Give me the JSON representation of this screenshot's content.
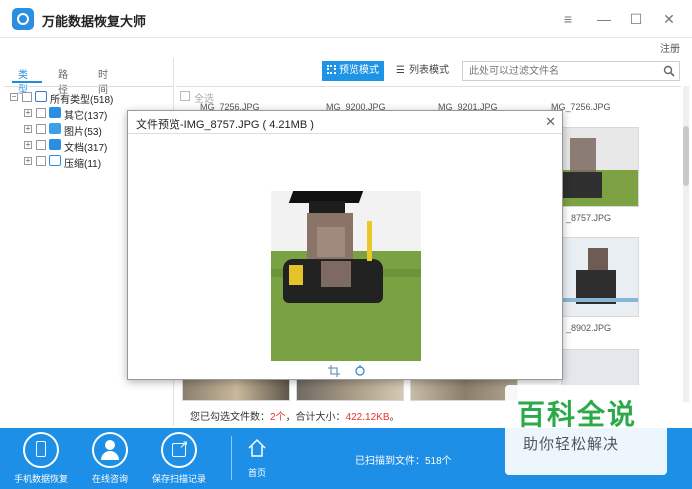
{
  "app": {
    "title": "万能数据恢复大师",
    "register": "注册"
  },
  "tabs": [
    "类型",
    "路径",
    "时间"
  ],
  "tree": [
    {
      "label": "所有类型(518)",
      "icon": "monitor-icon",
      "color": "#3a78c8"
    },
    {
      "label": "其它(137)",
      "icon": "grid-icon",
      "color": "#2a8fe0"
    },
    {
      "label": "图片(53)",
      "icon": "image-icon",
      "color": "#3aa0e8"
    },
    {
      "label": "文档(317)",
      "icon": "folder-icon",
      "color": "#2a8fe0"
    },
    {
      "label": "压缩(11)",
      "icon": "archive-icon",
      "color": "#2a8fe0"
    }
  ],
  "toolbar": {
    "preview_label": "预览模式",
    "list_label": "列表模式",
    "filter_placeholder": "此处可以过滤文件名"
  },
  "grid": {
    "select_all": "全选",
    "names": [
      "MG_7256.JPG",
      "MG_9200.JPG",
      "MG_9201.JPG",
      "MG_7256.JPG",
      "_8757.JPG",
      "_8902.JPG"
    ]
  },
  "status": {
    "prefix": "您已勾选文件数：",
    "count": "2个",
    "middle": "，合计大小：",
    "size": "422.12KB",
    "suffix": "。"
  },
  "bottom": {
    "phone_recover": "手机数据恢复",
    "online_consult": "在线咨询",
    "save_scan": "保存扫描记录",
    "home": "首页",
    "scanned": "已扫描到文件：518个"
  },
  "dialog": {
    "title": "文件预览-IMG_8757.JPG ( 4.21MB )"
  },
  "watermark": {
    "main": "百科全说",
    "sub": "助你轻松解决"
  }
}
